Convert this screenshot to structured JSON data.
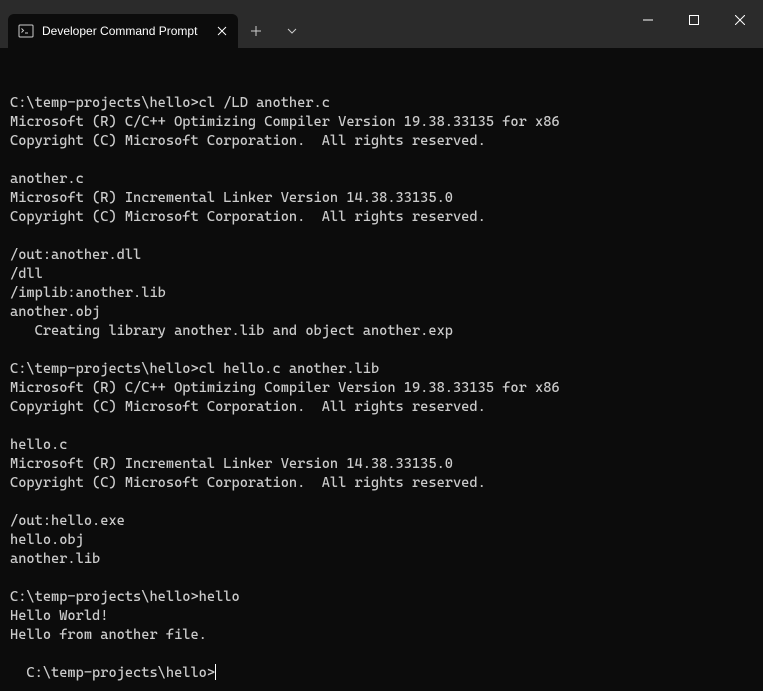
{
  "window": {
    "tab_title": "Developer Command Prompt"
  },
  "terminal": {
    "lines": [
      "C:\\temp-projects\\hello>cl /LD another.c",
      "Microsoft (R) C/C++ Optimizing Compiler Version 19.38.33135 for x86",
      "Copyright (C) Microsoft Corporation.  All rights reserved.",
      "",
      "another.c",
      "Microsoft (R) Incremental Linker Version 14.38.33135.0",
      "Copyright (C) Microsoft Corporation.  All rights reserved.",
      "",
      "/out:another.dll",
      "/dll",
      "/implib:another.lib",
      "another.obj",
      "   Creating library another.lib and object another.exp",
      "",
      "C:\\temp-projects\\hello>cl hello.c another.lib",
      "Microsoft (R) C/C++ Optimizing Compiler Version 19.38.33135 for x86",
      "Copyright (C) Microsoft Corporation.  All rights reserved.",
      "",
      "hello.c",
      "Microsoft (R) Incremental Linker Version 14.38.33135.0",
      "Copyright (C) Microsoft Corporation.  All rights reserved.",
      "",
      "/out:hello.exe",
      "hello.obj",
      "another.lib",
      "",
      "C:\\temp-projects\\hello>hello",
      "Hello World!",
      "Hello from another file."
    ],
    "prompt": "C:\\temp-projects\\hello>"
  }
}
